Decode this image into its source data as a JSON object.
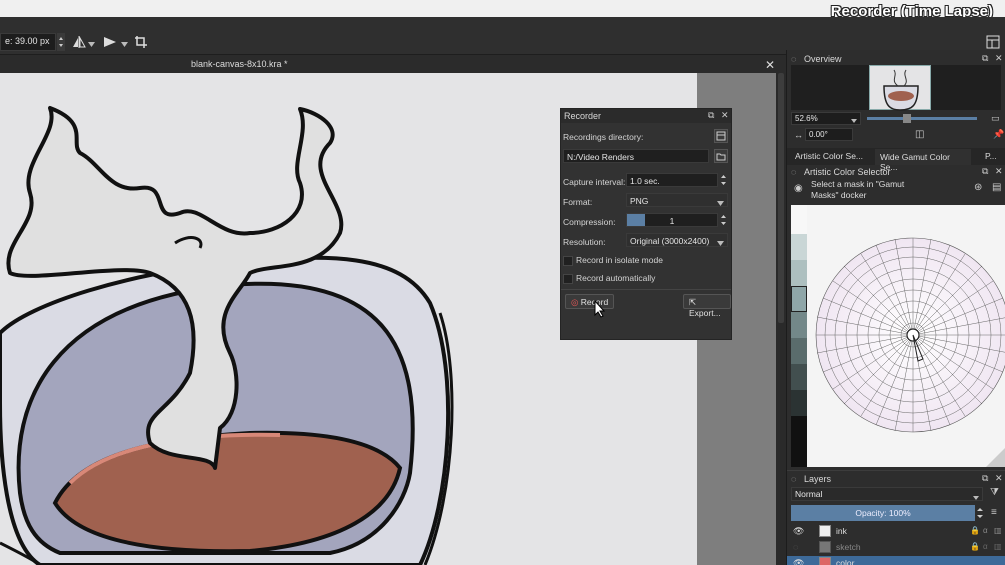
{
  "overlay_title": "Recorder (Time Lapse)",
  "toolbar": {
    "size_value": "e: 39.00 px"
  },
  "document": {
    "tab_title": "blank-canvas-8x10.kra *"
  },
  "overview": {
    "title": "Overview",
    "zoom": "52.6%",
    "rotation": "0.00°"
  },
  "color_tabs": [
    "Artistic Color Se...",
    "Wide Gamut Color Se...",
    "P..."
  ],
  "color_selector": {
    "title": "Artistic Color Selector",
    "mask_hint_line1": "Select a mask in \"Gamut",
    "mask_hint_line2": "Masks\" docker"
  },
  "recorder": {
    "title": "Recorder",
    "recordings_directory_label": "Recordings directory:",
    "directory_value": "N:/Video Renders",
    "capture_interval_label": "Capture interval:",
    "capture_interval_value": "1.0 sec.",
    "format_label": "Format:",
    "format_value": "PNG",
    "compression_label": "Compression:",
    "compression_value": "1",
    "resolution_label": "Resolution:",
    "resolution_value": "Original (3000x2400)",
    "isolate_label": "Record in isolate mode",
    "auto_label": "Record automatically",
    "record_button": "Record",
    "export_button": "Export..."
  },
  "layers": {
    "title": "Layers",
    "blend_mode": "Normal",
    "opacity_label": "Opacity:  100%",
    "items": [
      {
        "name": "ink"
      },
      {
        "name": "sketch"
      },
      {
        "name": "color"
      }
    ]
  },
  "colors": {
    "accent": "#5b7fa4",
    "layer_selected": "#3d6a99",
    "coffee": "#a0614f",
    "cup_inside": "#a3a5bd",
    "canvas_bg": "#e4e4e6"
  }
}
